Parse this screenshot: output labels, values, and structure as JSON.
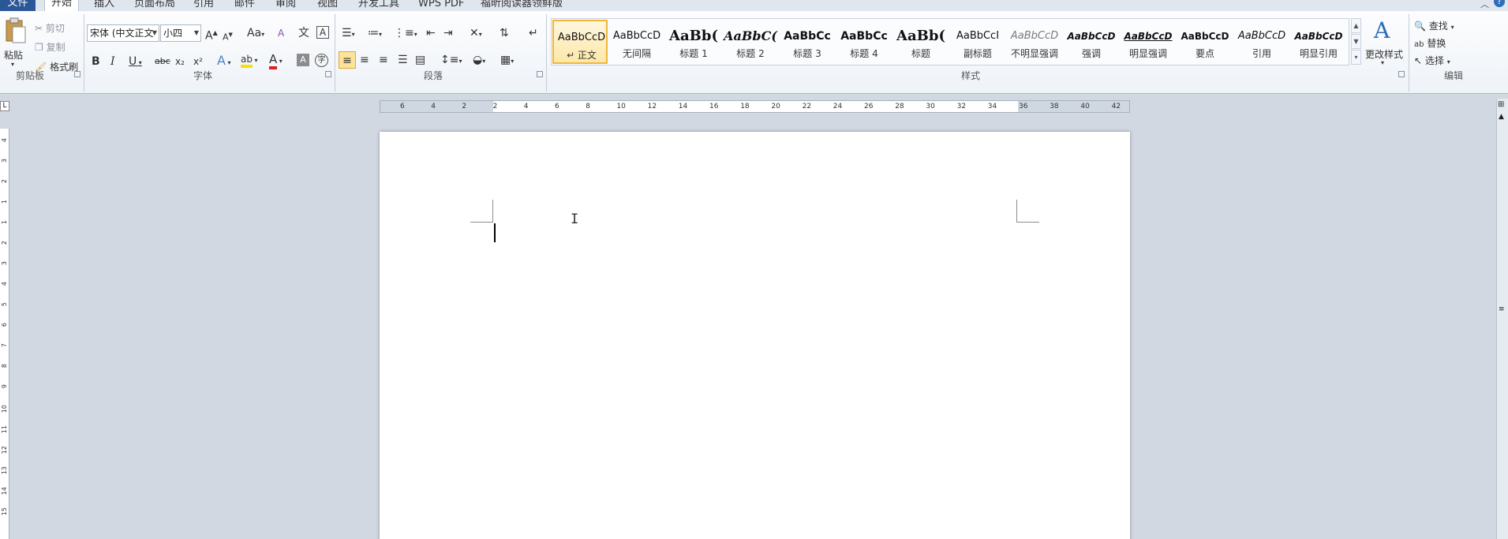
{
  "tabs": {
    "file": "文件",
    "home": "开始",
    "insert": "插入",
    "page_layout": "页面布局",
    "references": "引用",
    "mailings": "邮件",
    "review": "审阅",
    "view": "视图",
    "developer": "开发工具",
    "wps_pdf": "WPS PDF",
    "foxit": "福昕阅读器领鲜版"
  },
  "clipboard": {
    "paste": "粘贴",
    "cut": "剪切",
    "copy": "复制",
    "format_painter": "格式刷",
    "group_label": "剪贴板"
  },
  "font": {
    "name": "宋体 (中文正文",
    "size": "小四",
    "grow_label": "A",
    "shrink_label": "A",
    "change_case_label": "Aa",
    "phonetic_label": "文",
    "char_border_label": "A",
    "bold": "B",
    "italic": "I",
    "underline": "U",
    "strike": "abc",
    "sub": "x₂",
    "sup": "x²",
    "effects_label": "A",
    "highlight_label": "ab",
    "color_label": "A",
    "shading_label": "A",
    "enclose_label": "字",
    "group_label": "字体",
    "colors": {
      "highlight": "#f5e200",
      "font_color": "#e0201b"
    }
  },
  "paragraph": {
    "group_label": "段落"
  },
  "styles": {
    "group_label": "样式",
    "items": [
      {
        "preview": "AaBbCcD",
        "name": "↵ 正文"
      },
      {
        "preview": "AaBbCcD",
        "name": "无间隔"
      },
      {
        "preview": "AaBb(",
        "name": "标题 1"
      },
      {
        "preview": "AaBbC(",
        "name": "标题 2"
      },
      {
        "preview": "AaBbCc",
        "name": "标题 3"
      },
      {
        "preview": "AaBbCc",
        "name": "标题 4"
      },
      {
        "preview": "AaBb(",
        "name": "标题"
      },
      {
        "preview": "AaBbCcI",
        "name": "副标题"
      },
      {
        "preview": "AaBbCcD",
        "name": "不明显强调"
      },
      {
        "preview": "AaBbCcD",
        "name": "强调"
      },
      {
        "preview": "AaBbCcD",
        "name": "明显强调"
      },
      {
        "preview": "AaBbCcD",
        "name": "要点"
      },
      {
        "preview": "AaBbCcD",
        "name": "引用"
      },
      {
        "preview": "AaBbCcD",
        "name": "明显引用"
      }
    ],
    "change_styles": "更改样式"
  },
  "editing": {
    "group_label": "编辑",
    "find": "查找",
    "replace": "替换",
    "select": "选择"
  },
  "ruler": {
    "ticks": [
      "6",
      "4",
      "2",
      "2",
      "4",
      "6",
      "8",
      "10",
      "12",
      "14",
      "16",
      "18",
      "20",
      "22",
      "24",
      "26",
      "28",
      "30",
      "32",
      "34",
      "36",
      "38",
      "40",
      "42"
    ],
    "vticks": [
      "4",
      "3",
      "2",
      "1",
      "1",
      "2",
      "3",
      "4",
      "5",
      "6",
      "7",
      "8",
      "9",
      "10",
      "11",
      "12",
      "13",
      "14",
      "15"
    ]
  },
  "colors": {
    "accent": "#2b5797",
    "selected_style": "#f1b53c"
  }
}
